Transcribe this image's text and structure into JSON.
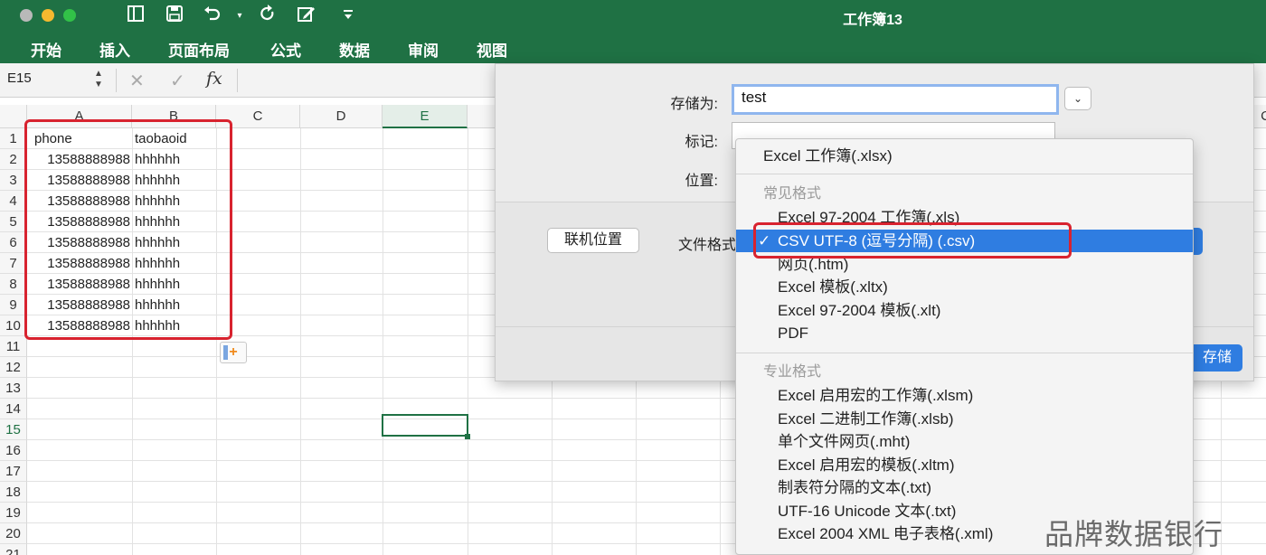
{
  "window": {
    "title": "工作簿13",
    "colors": {
      "titlebar": "#1f7144",
      "close": "#b9b9b9",
      "minimize": "#f5b92f",
      "zoom": "#32c148"
    }
  },
  "toolbar_icons": [
    "sidebar-icon",
    "save-icon",
    "undo-icon",
    "redo-icon",
    "edit-icon",
    "customize-icon"
  ],
  "ribbon": {
    "tabs": [
      "开始",
      "插入",
      "页面布局",
      "公式",
      "数据",
      "审阅",
      "视图"
    ]
  },
  "formula_bar": {
    "name_box": "E15",
    "cancel_symbol": "✕",
    "enter_symbol": "✓",
    "fx_label": "fx"
  },
  "sheet": {
    "columns": [
      "A",
      "B",
      "C",
      "D",
      "E"
    ],
    "far_column": "C",
    "active_column": "E",
    "active_row": "15",
    "rows": [
      "1",
      "2",
      "3",
      "4",
      "5",
      "6",
      "7",
      "8",
      "9",
      "10",
      "11",
      "12",
      "13",
      "14",
      "15",
      "16",
      "17",
      "18",
      "19",
      "20",
      "21"
    ],
    "header": {
      "a": "phone",
      "b": "taobaoid"
    },
    "data": [
      {
        "a": "13588888988",
        "b": "hhhhhh"
      },
      {
        "a": "13588888988",
        "b": "hhhhhh"
      },
      {
        "a": "13588888988",
        "b": "hhhhhh"
      },
      {
        "a": "13588888988",
        "b": "hhhhhh"
      },
      {
        "a": "13588888988",
        "b": "hhhhhh"
      },
      {
        "a": "13588888988",
        "b": "hhhhhh"
      },
      {
        "a": "13588888988",
        "b": "hhhhhh"
      },
      {
        "a": "13588888988",
        "b": "hhhhhh"
      },
      {
        "a": "13588888988",
        "b": "hhhhhh"
      }
    ],
    "paste_options_icon": "paste-options-icon",
    "highlight_color": "#d8232f"
  },
  "dialog": {
    "save_as_label": "存储为:",
    "filename": "test",
    "tags_label": "标记:",
    "location_label": "位置:",
    "online_locations_button": "联机位置",
    "file_format_label": "文件格式",
    "save_button": "存储",
    "accent": "#2f7de1"
  },
  "format_menu": {
    "top_item": "Excel 工作簿(.xlsx)",
    "common_header": "常见格式",
    "common_items": [
      "Excel 97-2004 工作簿(.xls)",
      "CSV UTF-8 (逗号分隔) (.csv)",
      "网页(.htm)",
      "Excel 模板(.xltx)",
      "Excel 97-2004 模板(.xlt)",
      "PDF"
    ],
    "selected_check": "✓",
    "pro_header": "专业格式",
    "pro_items": [
      "Excel 启用宏的工作簿(.xlsm)",
      "Excel 二进制工作簿(.xlsb)",
      "单个文件网页(.mht)",
      "Excel 启用宏的模板(.xltm)",
      "制表符分隔的文本(.txt)",
      "UTF-16 Unicode 文本(.txt)",
      "Excel 2004 XML 电子表格(.xml)"
    ]
  },
  "watermark": "品牌数据银行"
}
